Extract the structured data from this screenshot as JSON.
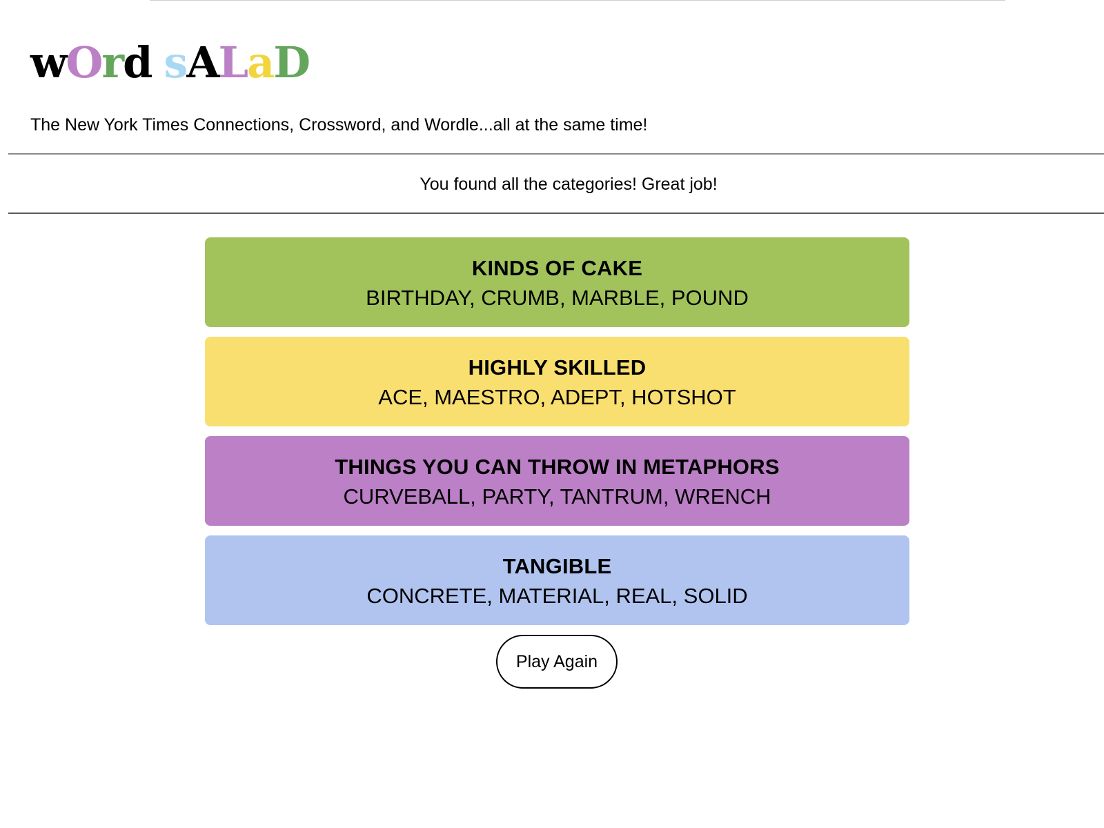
{
  "logo": {
    "letters": [
      {
        "char": "w",
        "color": "#000000"
      },
      {
        "char": "O",
        "color": "#bb80c6"
      },
      {
        "char": "r",
        "color": "#63a65c"
      },
      {
        "char": "d",
        "color": "#000000"
      },
      {
        "char": "s",
        "color": "#a9d8f5"
      },
      {
        "char": "A",
        "color": "#000000"
      },
      {
        "char": "L",
        "color": "#bb80c6"
      },
      {
        "char": "a",
        "color": "#f2d53c"
      },
      {
        "char": "D",
        "color": "#63a65c"
      }
    ]
  },
  "header": {
    "tagline": "The New York Times Connections, Crossword, and Wordle...all at the same time!"
  },
  "status": {
    "message": "You found all the categories! Great job!"
  },
  "categories": [
    {
      "title": "KINDS OF CAKE",
      "words": "BIRTHDAY, CRUMB, MARBLE, POUND",
      "color": "#a2c35c"
    },
    {
      "title": "HIGHLY SKILLED",
      "words": "ACE, MAESTRO, ADEPT, HOTSHOT",
      "color": "#f9df70"
    },
    {
      "title": "THINGS YOU CAN THROW IN METAPHORS",
      "words": "CURVEBALL, PARTY, TANTRUM, WRENCH",
      "color": "#bb80c6"
    },
    {
      "title": "TANGIBLE",
      "words": "CONCRETE, MATERIAL, REAL, SOLID",
      "color": "#b0c4ef"
    }
  ],
  "actions": {
    "play_again_label": "Play Again"
  }
}
